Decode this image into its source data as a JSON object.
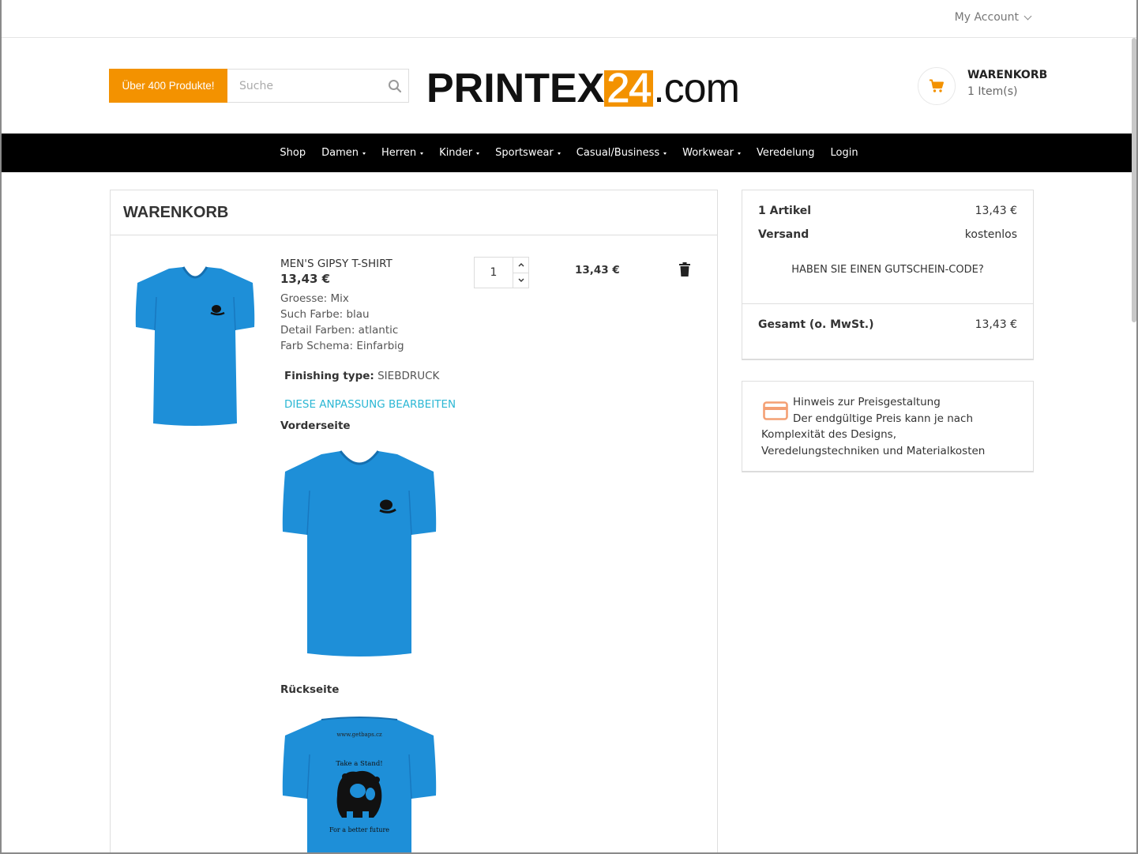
{
  "topbar": {
    "account_label": "My Account"
  },
  "header": {
    "promo_label": "Über 400 Produkte!",
    "search_placeholder": "Suche",
    "logo": {
      "part1": "PRINTEX",
      "part2": "24",
      "part3": ".com"
    },
    "cart": {
      "title": "WARENKORB",
      "count": "1 Item(s)"
    }
  },
  "nav": {
    "items": [
      {
        "label": "Shop"
      },
      {
        "label": "Damen"
      },
      {
        "label": "Herren"
      },
      {
        "label": "Kinder"
      },
      {
        "label": "Sportswear"
      },
      {
        "label": "Casual/Business"
      },
      {
        "label": "Workwear"
      },
      {
        "label": "Veredelung"
      },
      {
        "label": "Login"
      }
    ]
  },
  "cart_panel": {
    "title": "WARENKORB",
    "item": {
      "name": "MEN'S GIPSY T-SHIRT",
      "price": "13,43 €",
      "attributes": [
        "Groesse: Mix",
        "Such Farbe: blau",
        "Detail Farben: atlantic",
        "Farb Schema: Einfarbig"
      ],
      "finishing_label": "Finishing type:",
      "finishing_value": "SIEBDRUCK",
      "edit_label": "DIESE ANPASSUNG BEARBEITEN",
      "front_label": "Vorderseite",
      "back_label": "Rückseite",
      "back_print": {
        "url": "www.getbaps.cz",
        "slogan_top": "Take a Stand!",
        "slogan_bottom": "For a better future"
      },
      "quantity": "1",
      "line_total": "13,43 €"
    }
  },
  "summary": {
    "articles_label": "1 Artikel",
    "articles_value": "13,43 €",
    "shipping_label": "Versand",
    "shipping_value": "kostenlos",
    "voucher_label": "HABEN SIE EINEN GUTSCHEIN-CODE?",
    "total_label": "Gesamt (o. MwSt.)",
    "total_value": "13,43 €"
  },
  "notice": {
    "title": "Hinweis zur Preisgestaltung",
    "body": "Der endgültige Preis kann je nach Komplexität des Designs, Veredelungstechniken und Materialkosten"
  },
  "colors": {
    "accent": "#f39200",
    "nav_bg": "#000000",
    "link": "#2bb7d4",
    "shirt": "#1e8fd8",
    "notice_icon": "#f4a074"
  },
  "icons": {
    "search": "search-icon",
    "cart": "shopping-cart-icon",
    "trash": "trash-icon",
    "card": "credit-card-icon"
  }
}
